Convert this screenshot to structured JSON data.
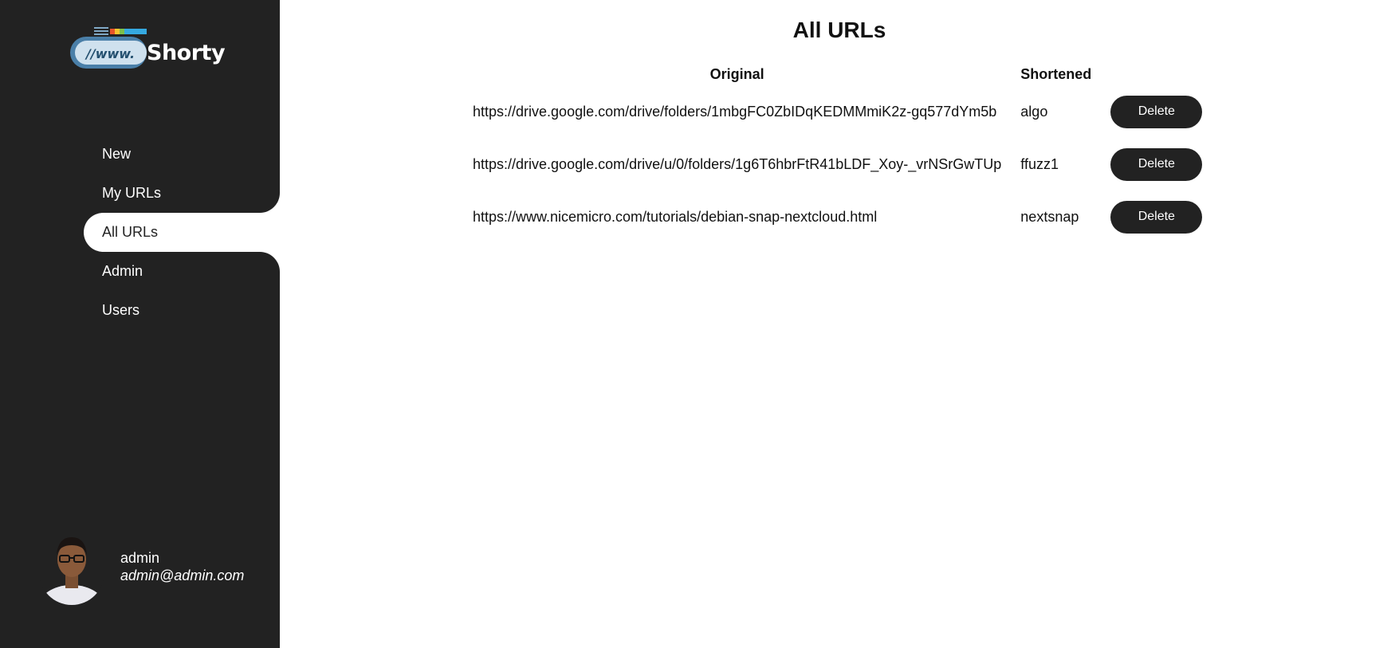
{
  "brand": {
    "name": "Shorty",
    "logo_text": "//www."
  },
  "nav": {
    "items": [
      {
        "label": "New"
      },
      {
        "label": "My URLs"
      },
      {
        "label": "All URLs"
      },
      {
        "label": "Admin"
      },
      {
        "label": "Users"
      }
    ],
    "active": "All URLs"
  },
  "user": {
    "name": "admin",
    "email": "admin@admin.com"
  },
  "main": {
    "title": "All URLs",
    "columns": {
      "original": "Original",
      "shortened": "Shortened"
    },
    "rows": [
      {
        "original": "https://drive.google.com/drive/folders/1mbgFC0ZbIDqKEDMMmiK2z-gq577dYm5b",
        "shortened": "algo",
        "action": "Delete"
      },
      {
        "original": "https://drive.google.com/drive/u/0/folders/1g6T6hbrFtR41bLDF_Xoy-_vrNSrGwTUp",
        "shortened": "ffuzz1",
        "action": "Delete"
      },
      {
        "original": "https://www.nicemicro.com/tutorials/debian-snap-nextcloud.html",
        "shortened": "nextsnap",
        "action": "Delete"
      }
    ]
  },
  "colors": {
    "sidebar": "#222222",
    "button": "#222222",
    "background": "#ffffff"
  }
}
